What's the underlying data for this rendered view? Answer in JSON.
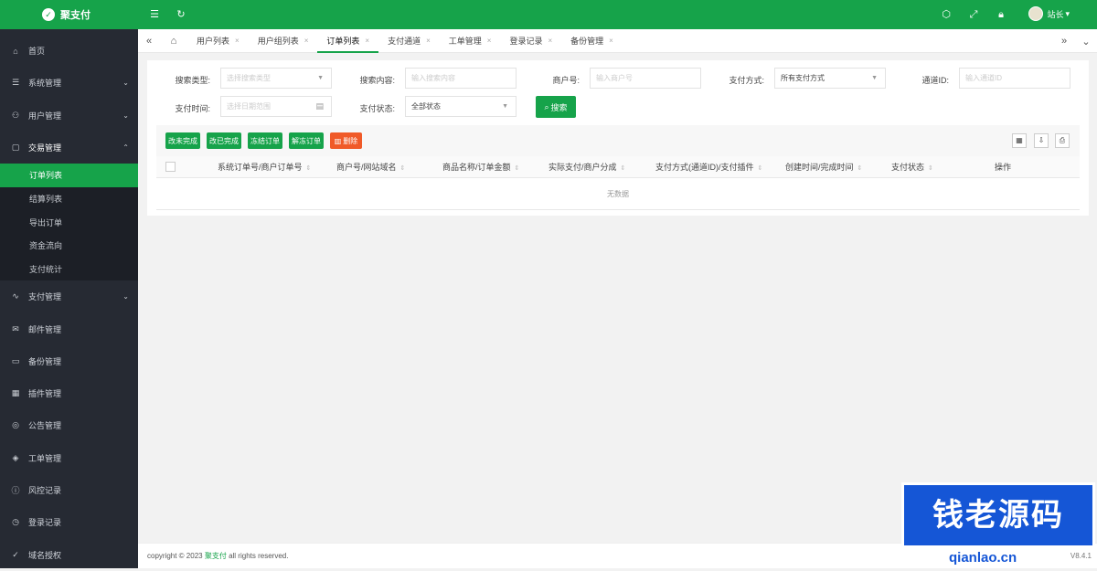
{
  "app": {
    "title": "聚支付",
    "logo_char": "✓"
  },
  "topbar": {
    "user_name": "站长",
    "user_caret": "▾",
    "icons": [
      "tag-icon",
      "fullscreen-icon",
      "lock-icon"
    ]
  },
  "sidebar": {
    "items": [
      {
        "label": "首页",
        "icon": "⌂"
      },
      {
        "label": "系统管理",
        "icon": "☰",
        "arrow": "⌄"
      },
      {
        "label": "用户管理",
        "icon": "⚇",
        "arrow": "⌄"
      },
      {
        "label": "交易管理",
        "icon": "▢",
        "arrow": "⌃"
      }
    ],
    "sub_items": [
      "订单列表",
      "结算列表",
      "导出订单",
      "资金流向",
      "支付统计"
    ],
    "items_after": [
      {
        "label": "支付管理",
        "icon": "∿",
        "arrow": "⌄"
      },
      {
        "label": "邮件管理",
        "icon": "✉"
      },
      {
        "label": "备份管理",
        "icon": "▭"
      },
      {
        "label": "插件管理",
        "icon": "▦"
      },
      {
        "label": "公告管理",
        "icon": "◎"
      },
      {
        "label": "工单管理",
        "icon": "◈"
      },
      {
        "label": "风控记录",
        "icon": "ⓘ"
      },
      {
        "label": "登录记录",
        "icon": "◷"
      },
      {
        "label": "域名授权",
        "icon": "✓"
      }
    ]
  },
  "tabs": {
    "home_icon": "⌂",
    "items": [
      "用户列表",
      "用户组列表",
      "订单列表",
      "支付通道",
      "工单管理",
      "登录记录",
      "备份管理"
    ],
    "active": "订单列表",
    "close": "×"
  },
  "search": {
    "type_label": "搜索类型:",
    "type_placeholder": "选择搜索类型",
    "content_label": "搜索内容:",
    "content_placeholder": "输入搜索内容",
    "merchant_label": "商户号:",
    "merchant_placeholder": "输入商户号",
    "paymethod_label": "支付方式:",
    "paymethod_value": "所有支付方式",
    "channel_label": "通道ID:",
    "channel_placeholder": "输入通道ID",
    "time_label": "支付时间:",
    "time_placeholder": "选择日期范围",
    "status_label": "支付状态:",
    "status_value": "全部状态",
    "search_button": "搜索"
  },
  "toolbar": {
    "buttons": [
      "改未完成",
      "改已完成",
      "冻结订单",
      "解冻订单",
      "删除"
    ]
  },
  "table": {
    "columns": [
      "系统订单号/商户订单号",
      "商户号/网站域名",
      "商品名称/订单金额",
      "实际支付/商户分成",
      "支付方式(通道ID)/支付插件",
      "创建时间/完成时间",
      "支付状态",
      "操作"
    ],
    "empty_text": "无数据"
  },
  "footer": {
    "copyright_prefix": "copyright © 2023",
    "brand": "聚支付",
    "copyright_suffix": "all rights reserved.",
    "version": "V8.4.1"
  },
  "watermark": {
    "title": "钱老源码",
    "url": "qianlao.cn"
  }
}
